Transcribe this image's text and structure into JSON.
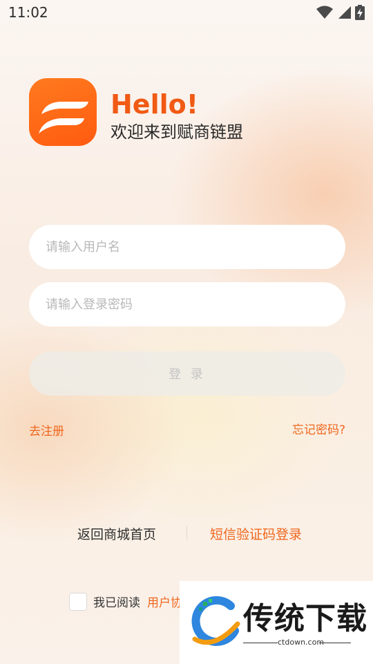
{
  "status_bar": {
    "time": "11:02",
    "icons": [
      "wifi-icon",
      "signal-icon",
      "battery-charging-icon"
    ]
  },
  "brand": {
    "hello": "Hello!",
    "welcome": "欢迎来到赋商链盟",
    "accent": "#f05a14"
  },
  "form": {
    "username_placeholder": "请输入用户名",
    "username_value": "",
    "password_placeholder": "请输入登录密码",
    "password_value": "",
    "login_label": "登 录"
  },
  "links": {
    "register": "去注册",
    "forgot": "忘记密码?"
  },
  "bottom": {
    "back_home": "返回商城首页",
    "sms_login": "短信验证码登录"
  },
  "agreement": {
    "prefix": "我已阅读",
    "link": "用户协"
  },
  "watermark": {
    "title": "传统下载",
    "site": "ctdown.com"
  }
}
